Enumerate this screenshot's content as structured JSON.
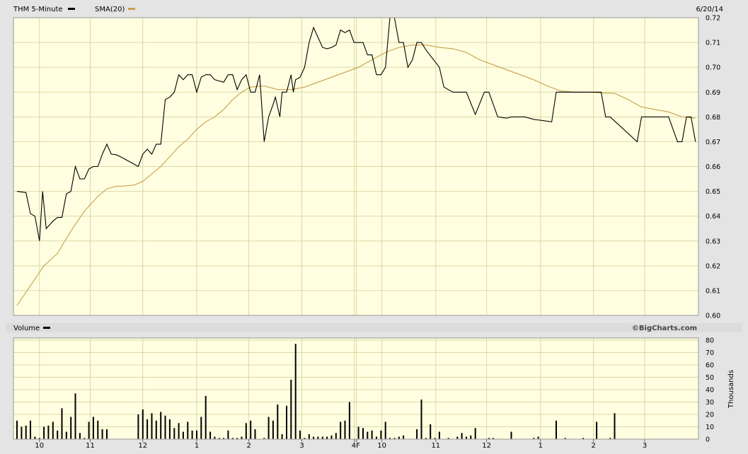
{
  "header": {
    "series_label": "THM 5-Minute",
    "sma_label": "SMA(20)",
    "date": "6/20/14"
  },
  "volume_header": {
    "label": "Volume",
    "brand": "©BigCharts.com"
  },
  "colors": {
    "background": "#e4e4e4",
    "plot_bg": "#fffee0",
    "grid": "#d8d9a8",
    "price_line": "#000000",
    "sma_line": "#c8a04c",
    "volume_bar": "#000000"
  },
  "chart_data": [
    {
      "type": "line",
      "x_ticks": [
        "10",
        "11",
        "12",
        "1",
        "2",
        "3",
        "4F",
        "10",
        "11",
        "12",
        "1",
        "2",
        "3"
      ],
      "x_range": [
        0,
        133
      ],
      "ylim": [
        0.6,
        0.72
      ],
      "y_ticks": [
        "0.72",
        "0.71",
        "0.70",
        "0.69",
        "0.68",
        "0.67",
        "0.66",
        "0.65",
        "0.64",
        "0.63",
        "0.62",
        "0.61",
        "0.60"
      ],
      "grid": true,
      "legend": "top-left",
      "series": [
        {
          "name": "THM 5-Minute",
          "color": "#000000",
          "points": [
            [
              0,
              0.65
            ],
            [
              2,
              0.6495
            ],
            [
              3,
              0.641
            ],
            [
              4,
              0.64
            ],
            [
              5,
              0.63
            ],
            [
              5.7,
              0.65
            ],
            [
              6.5,
              0.635
            ],
            [
              8,
              0.638
            ],
            [
              9,
              0.6395
            ],
            [
              10,
              0.6395
            ],
            [
              11,
              0.649
            ],
            [
              12,
              0.65
            ],
            [
              13,
              0.66
            ],
            [
              14,
              0.655
            ],
            [
              15,
              0.655
            ],
            [
              16,
              0.659
            ],
            [
              17,
              0.66
            ],
            [
              18,
              0.66
            ],
            [
              19,
              0.665
            ],
            [
              20,
              0.669
            ],
            [
              21,
              0.665
            ],
            [
              22,
              0.6648
            ],
            [
              23,
              0.664
            ],
            [
              25,
              0.662
            ],
            [
              27,
              0.66
            ],
            [
              28,
              0.665
            ],
            [
              29,
              0.667
            ],
            [
              30,
              0.665
            ],
            [
              31,
              0.669
            ],
            [
              32,
              0.669
            ],
            [
              33,
              0.687
            ],
            [
              34,
              0.688
            ],
            [
              35,
              0.69
            ],
            [
              36,
              0.697
            ],
            [
              37,
              0.695
            ],
            [
              38,
              0.697
            ],
            [
              39,
              0.697
            ],
            [
              40,
              0.69
            ],
            [
              41,
              0.696
            ],
            [
              42,
              0.697
            ],
            [
              43,
              0.697
            ],
            [
              44,
              0.695
            ],
            [
              45,
              0.6945
            ],
            [
              46,
              0.694
            ],
            [
              47,
              0.697
            ],
            [
              48,
              0.697
            ],
            [
              49,
              0.691
            ],
            [
              50,
              0.695
            ],
            [
              51,
              0.697
            ],
            [
              52,
              0.69
            ],
            [
              53,
              0.69
            ],
            [
              54,
              0.697
            ],
            [
              55,
              0.67
            ],
            [
              56,
              0.68
            ],
            [
              57,
              0.685
            ],
            [
              57.5,
              0.688
            ],
            [
              58.5,
              0.68
            ],
            [
              59,
              0.69
            ],
            [
              60,
              0.69
            ],
            [
              61,
              0.697
            ],
            [
              61.5,
              0.69
            ],
            [
              62,
              0.695
            ],
            [
              63,
              0.696
            ],
            [
              64,
              0.7
            ],
            [
              65,
              0.71
            ],
            [
              66,
              0.716
            ],
            [
              68,
              0.708
            ],
            [
              69,
              0.7075
            ],
            [
              70,
              0.708
            ],
            [
              71,
              0.709
            ],
            [
              72,
              0.715
            ],
            [
              73,
              0.714
            ],
            [
              74,
              0.715
            ],
            [
              75,
              0.71
            ],
            [
              76,
              0.71
            ],
            [
              77,
              0.71
            ],
            [
              78,
              0.705
            ],
            [
              79,
              0.705
            ],
            [
              80,
              0.697
            ],
            [
              81,
              0.697
            ],
            [
              82,
              0.7
            ],
            [
              83,
              0.72
            ],
            [
              84,
              0.72
            ],
            [
              85,
              0.71
            ],
            [
              86,
              0.71
            ],
            [
              87,
              0.7
            ],
            [
              88,
              0.703
            ],
            [
              89,
              0.71
            ],
            [
              90,
              0.71
            ],
            [
              91,
              0.707
            ],
            [
              94,
              0.7
            ],
            [
              95,
              0.692
            ],
            [
              97,
              0.69
            ],
            [
              100,
              0.69
            ],
            [
              102,
              0.681
            ],
            [
              104,
              0.69
            ],
            [
              105,
              0.69
            ],
            [
              107,
              0.68
            ],
            [
              109,
              0.6795
            ],
            [
              110,
              0.68
            ],
            [
              113,
              0.68
            ],
            [
              115,
              0.679
            ],
            [
              119,
              0.678
            ],
            [
              120,
              0.69
            ],
            [
              130,
              0.69
            ],
            [
              131,
              0.68
            ],
            [
              132,
              0.68
            ],
            [
              138,
              0.67
            ],
            [
              139,
              0.68
            ],
            [
              143,
              0.68
            ],
            [
              144,
              0.68
            ],
            [
              145,
              0.68
            ],
            [
              147,
              0.67
            ],
            [
              148,
              0.67
            ],
            [
              149,
              0.68
            ],
            [
              150,
              0.68
            ],
            [
              151,
              0.67
            ]
          ]
        },
        {
          "name": "SMA(20)",
          "color": "#c8a04c",
          "points": [
            [
              0,
              0.604
            ],
            [
              3,
              0.612
            ],
            [
              6,
              0.62
            ],
            [
              9,
              0.625
            ],
            [
              12,
              0.634
            ],
            [
              15,
              0.642
            ],
            [
              18,
              0.648
            ],
            [
              20,
              0.651
            ],
            [
              22,
              0.652
            ],
            [
              24,
              0.6522
            ],
            [
              26,
              0.6525
            ],
            [
              28,
              0.654
            ],
            [
              30,
              0.657
            ],
            [
              32,
              0.66
            ],
            [
              34,
              0.664
            ],
            [
              36,
              0.668
            ],
            [
              38,
              0.671
            ],
            [
              40,
              0.675
            ],
            [
              42,
              0.678
            ],
            [
              44,
              0.68
            ],
            [
              46,
              0.683
            ],
            [
              48,
              0.687
            ],
            [
              50,
              0.69
            ],
            [
              52,
              0.692
            ],
            [
              55,
              0.6925
            ],
            [
              58,
              0.691
            ],
            [
              61,
              0.691
            ],
            [
              64,
              0.692
            ],
            [
              67,
              0.694
            ],
            [
              70,
              0.696
            ],
            [
              73,
              0.698
            ],
            [
              76,
              0.7
            ],
            [
              79,
              0.703
            ],
            [
              82,
              0.706
            ],
            [
              85,
              0.708
            ],
            [
              88,
              0.709
            ],
            [
              91,
              0.709
            ],
            [
              94,
              0.708
            ],
            [
              97,
              0.7075
            ],
            [
              100,
              0.706
            ],
            [
              103,
              0.703
            ],
            [
              106,
              0.701
            ],
            [
              109,
              0.699
            ],
            [
              112,
              0.697
            ],
            [
              115,
              0.695
            ],
            [
              118,
              0.6925
            ],
            [
              121,
              0.6905
            ],
            [
              124,
              0.69
            ],
            [
              127,
              0.69
            ],
            [
              130,
              0.6897
            ],
            [
              133,
              0.6895
            ],
            [
              136,
              0.687
            ],
            [
              139,
              0.684
            ],
            [
              142,
              0.683
            ],
            [
              145,
              0.682
            ],
            [
              148,
              0.68
            ],
            [
              151,
              0.6795
            ]
          ]
        }
      ]
    },
    {
      "type": "bar",
      "ylabel": "Thousands",
      "ylim": [
        0,
        80
      ],
      "y_ticks": [
        "80",
        "70",
        "60",
        "50",
        "40",
        "30",
        "20",
        "10",
        "0"
      ],
      "grid": true,
      "values": [
        [
          0,
          15
        ],
        [
          1,
          10
        ],
        [
          2,
          11
        ],
        [
          3,
          15
        ],
        [
          4,
          2
        ],
        [
          5,
          1
        ],
        [
          6,
          10
        ],
        [
          7,
          11
        ],
        [
          8,
          14
        ],
        [
          9,
          7
        ],
        [
          10,
          25
        ],
        [
          11,
          6
        ],
        [
          12,
          18
        ],
        [
          13,
          37
        ],
        [
          14,
          5
        ],
        [
          15,
          1
        ],
        [
          16,
          14
        ],
        [
          17,
          18
        ],
        [
          18,
          15
        ],
        [
          19,
          8
        ],
        [
          20,
          8
        ],
        [
          27,
          20
        ],
        [
          28,
          24
        ],
        [
          29,
          16
        ],
        [
          30,
          21
        ],
        [
          31,
          15
        ],
        [
          32,
          22
        ],
        [
          33,
          19
        ],
        [
          34,
          16
        ],
        [
          35,
          9
        ],
        [
          36,
          13
        ],
        [
          37,
          6
        ],
        [
          38,
          14
        ],
        [
          39,
          7
        ],
        [
          40,
          7
        ],
        [
          41,
          18
        ],
        [
          42,
          35
        ],
        [
          43,
          6
        ],
        [
          44,
          2
        ],
        [
          45,
          1
        ],
        [
          46,
          1
        ],
        [
          47,
          7
        ],
        [
          48,
          1
        ],
        [
          49,
          1
        ],
        [
          50,
          2
        ],
        [
          51,
          13
        ],
        [
          52,
          15
        ],
        [
          53,
          8
        ],
        [
          55,
          1
        ],
        [
          56,
          18
        ],
        [
          57,
          15
        ],
        [
          58,
          28
        ],
        [
          59,
          4
        ],
        [
          60,
          27
        ],
        [
          61,
          48
        ],
        [
          62,
          77
        ],
        [
          63,
          7
        ],
        [
          64,
          1
        ],
        [
          65,
          4
        ],
        [
          66,
          2
        ],
        [
          67,
          2
        ],
        [
          68,
          2
        ],
        [
          69,
          2
        ],
        [
          70,
          3
        ],
        [
          71,
          5
        ],
        [
          72,
          14
        ],
        [
          73,
          15
        ],
        [
          74,
          30
        ],
        [
          76,
          10
        ],
        [
          77,
          9
        ],
        [
          78,
          6
        ],
        [
          79,
          7
        ],
        [
          80,
          2
        ],
        [
          81,
          7
        ],
        [
          82,
          14
        ],
        [
          83,
          1
        ],
        [
          84,
          1
        ],
        [
          85,
          2
        ],
        [
          86,
          3
        ],
        [
          89,
          8
        ],
        [
          90,
          32
        ],
        [
          91,
          1
        ],
        [
          92,
          12
        ],
        [
          93,
          1
        ],
        [
          94,
          6
        ],
        [
          96,
          1
        ],
        [
          98,
          2
        ],
        [
          99,
          5
        ],
        [
          100,
          2
        ],
        [
          101,
          3
        ],
        [
          102,
          9
        ],
        [
          105,
          1
        ],
        [
          106,
          1
        ],
        [
          110,
          6
        ],
        [
          115,
          1
        ],
        [
          116,
          2
        ],
        [
          120,
          15
        ],
        [
          122,
          1
        ],
        [
          126,
          1
        ],
        [
          129,
          14
        ],
        [
          132,
          1
        ],
        [
          133,
          21
        ]
      ]
    }
  ]
}
